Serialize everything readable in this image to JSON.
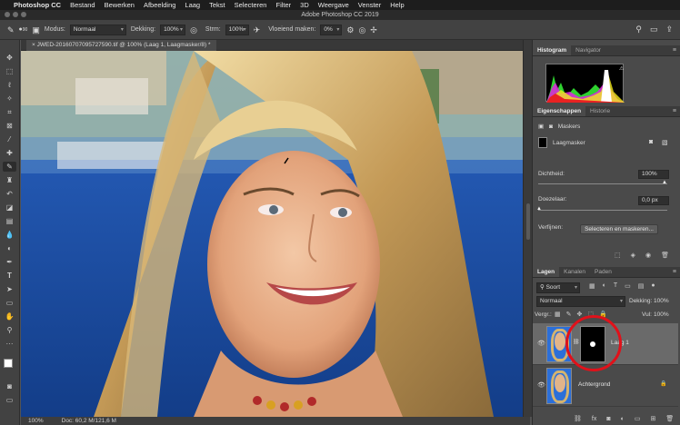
{
  "menubar": {
    "app": "Photoshop CC",
    "items": [
      "Bestand",
      "Bewerken",
      "Afbeelding",
      "Laag",
      "Tekst",
      "Selecteren",
      "Filter",
      "3D",
      "Weergave",
      "Venster",
      "Help"
    ]
  },
  "window_title": "Adobe Photoshop CC 2019",
  "options": {
    "brush_size": "90",
    "mode_label": "Modus:",
    "mode_value": "Normaal",
    "opacity_label": "Dekking:",
    "opacity_value": "100%",
    "flow_label": "Strm:",
    "flow_value": "100%",
    "smoothing_label": "Vloeiend maken:",
    "smoothing_value": "0%"
  },
  "document": {
    "tab_title": "JWED-20160707095727590.tif @ 100% (Laag 1, Laagmasker/8) *",
    "zoom": "100%",
    "doc_info": "Doc: 60,2 M/121,6 M"
  },
  "panels": {
    "top_tabs": [
      "Histogram",
      "Navigator"
    ],
    "props_tabs": [
      "Eigenschappen",
      "Historie"
    ],
    "masks_label": "Maskers",
    "layermask_label": "Laagmasker",
    "density_label": "Dichtheid:",
    "density_value": "100%",
    "feather_label": "Doezelaar:",
    "feather_value": "0,0 px",
    "refine_label": "Verfijnen:",
    "refine_button": "Selecteren en maskeren...",
    "layers_tabs": [
      "Lagen",
      "Kanalen",
      "Paden"
    ],
    "kind_label": "Soort",
    "blend_mode": "Normaal",
    "opacity_label": "Dekking:",
    "opacity_value": "100%",
    "lock_label": "Vergr.:",
    "fill_label": "Vul:",
    "fill_value": "100%",
    "layers": [
      {
        "name": "Laag 1"
      },
      {
        "name": "Achtergrond"
      }
    ]
  },
  "colors": {
    "highlight_ring": "#e0111a",
    "accent_blue": "#2c6fd8"
  }
}
